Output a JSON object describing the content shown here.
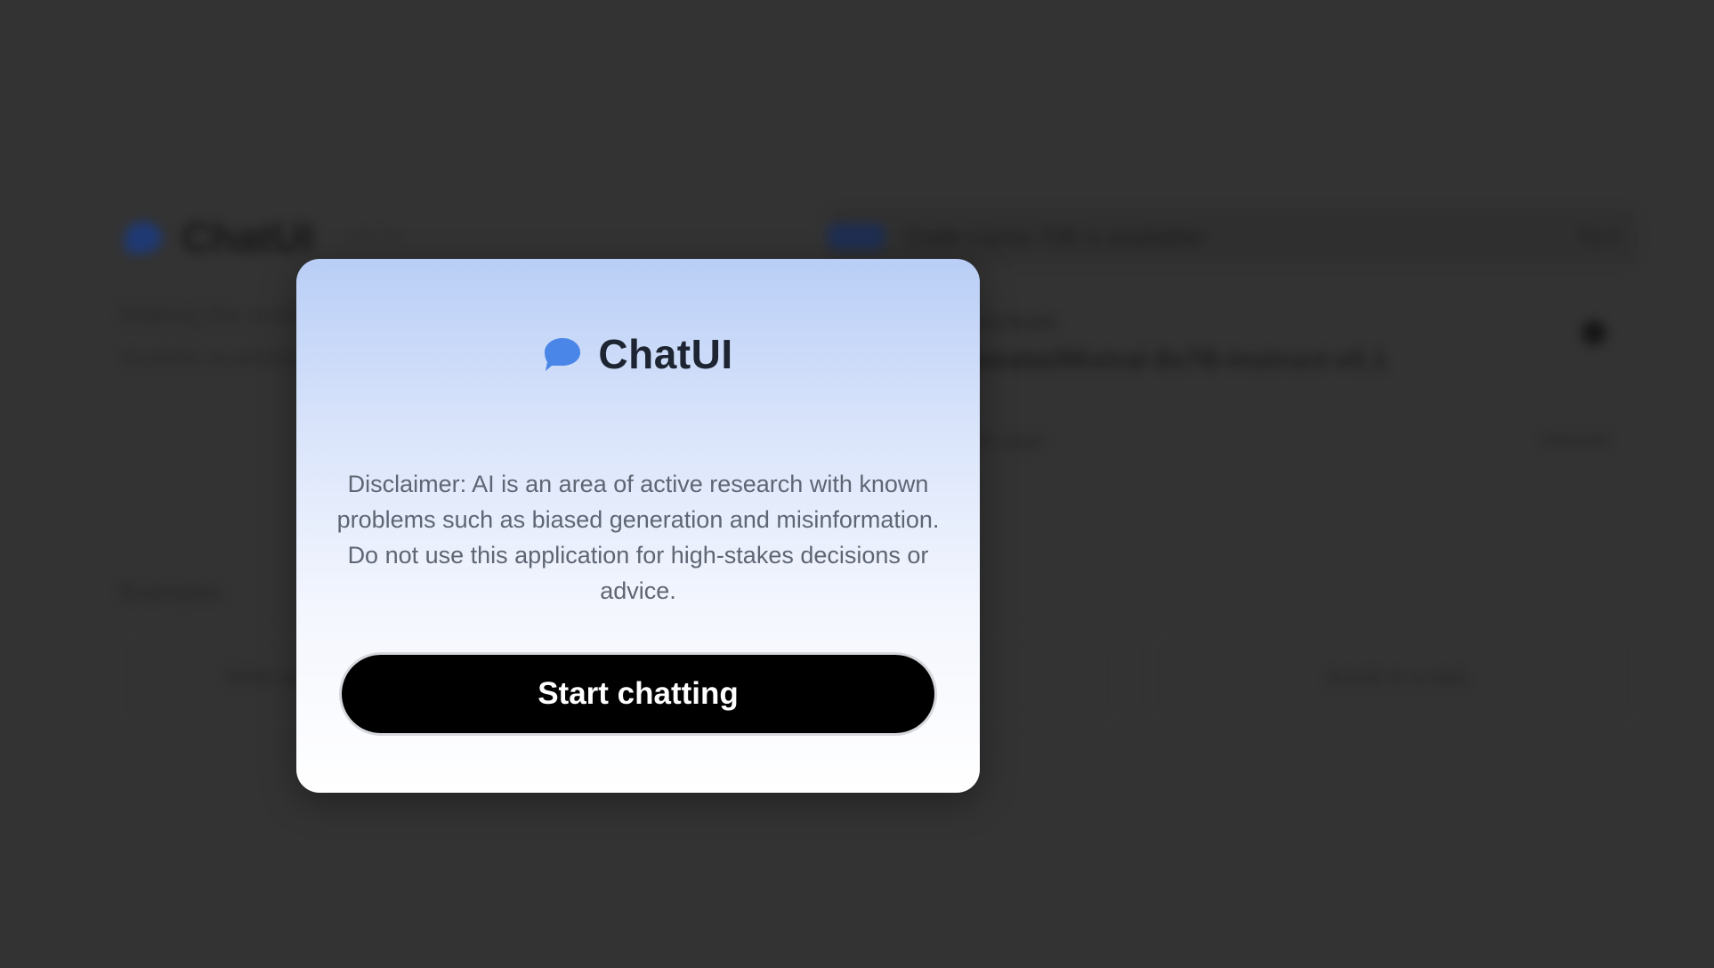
{
  "background": {
    "app_name": "ChatUI",
    "version": "v0.7.0",
    "description": "Making the community's best AI chat models available to everyone.",
    "announcement": {
      "badge": "New",
      "text": "Code Llama 70B is available!",
      "link": "Try it"
    },
    "model": {
      "label": "Current Model",
      "name": "mistralai/Mixtral-8x7B-Instruct-v0.1",
      "footer_left": "Model page",
      "footer_right": "Website"
    },
    "examples_title": "Examples",
    "examples": [
      "Write an email from bullet list",
      "Code a snake game",
      "Assist in a task"
    ]
  },
  "modal": {
    "icon": "chat-bubble-icon",
    "title": "ChatUI",
    "disclaimer": "Disclaimer: AI is an area of active research with known problems such as biased generation and misinformation. Do not use this application for high-stakes decisions or advice.",
    "start_button": "Start chatting"
  },
  "colors": {
    "overlay": "#333333",
    "brand_blue": "#4a86e8",
    "modal_gradient_top": "#b9cef6",
    "button_bg": "#000000",
    "title_text": "#1e2532",
    "disclaimer_text": "#5f6673"
  }
}
